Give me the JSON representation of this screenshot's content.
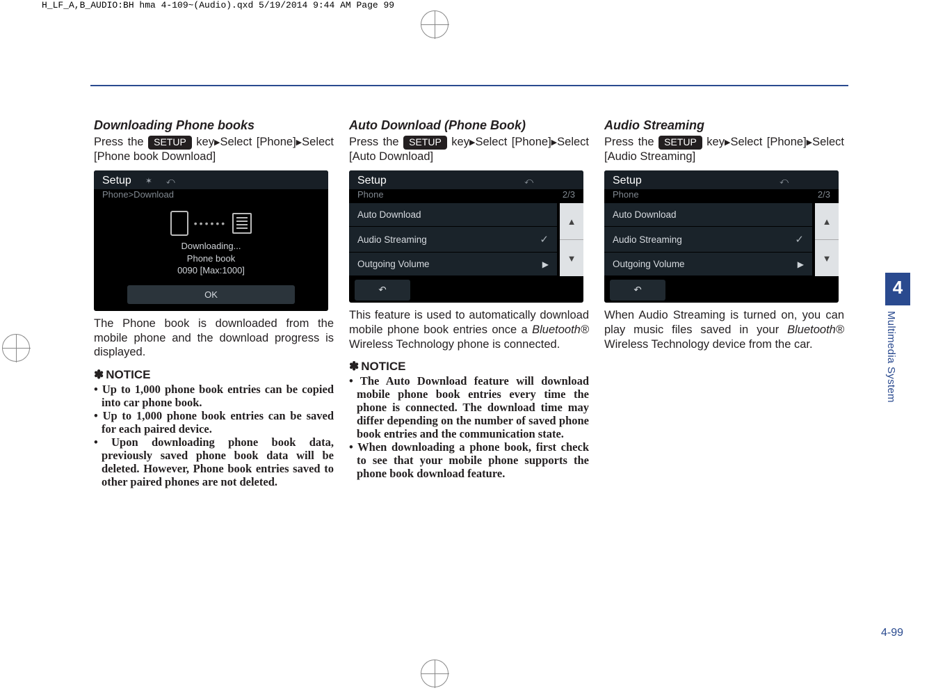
{
  "header_line": "H_LF_A,B_AUDIO:BH hma 4-109~(Audio).qxd  5/19/2014  9:44 AM  Page 99",
  "setup_label": "SETUP",
  "col1": {
    "title": "Downloading Phone books",
    "instr_pre": "Press  the  ",
    "instr_post": "  key",
    "instr_tail": "Select [Phone]",
    "instr_tail2": "Select  [Phone  book Download]",
    "ss": {
      "title": "Setup",
      "breadcrumb": "Phone>Download",
      "downloading": "Downloading...",
      "phonebook": "Phone book",
      "progress": "0090 [Max:1000]",
      "ok": "OK"
    },
    "after_ss": "The Phone book is downloaded from the mobile phone and the download progress is displayed.",
    "notice": "NOTICE",
    "b1": "Up to 1,000 phone book entries can be copied into car phone book.",
    "b2": "Up to 1,000 phone book entries can be saved for each paired device.",
    "b3": "Upon downloading phone book data, previously saved phone book data will be deleted. However, Phone book entries saved to other paired phones are not deleted."
  },
  "col2": {
    "title": "Auto Download (Phone Book)",
    "instr_pre": "Press  the  ",
    "instr_post": "  key",
    "instr_tail": "Select [Phone]",
    "instr_tail2": "Select [Auto Download]",
    "ss": {
      "title": "Setup",
      "sub": "Phone",
      "page": "2/3",
      "row1": "Auto Download",
      "row2": "Audio Streaming",
      "row3": "Outgoing Volume"
    },
    "after_ss_a": "This feature is used to automatically download mobile phone book entries once a ",
    "bt": "Bluetooth®",
    "after_ss_b": " Wireless Technology phone is connected.",
    "notice": "NOTICE",
    "b1": "The Auto Download feature will download mobile phone book entries every time the phone is connected. The download time may differ depending on the number of saved phone book entries and the communication state.",
    "b2": "When downloading a phone book, first check to see that your mobile phone supports the phone book download feature."
  },
  "col3": {
    "title": "Audio Streaming",
    "instr_pre": "Press  the  ",
    "instr_post": "  key",
    "instr_tail": "Select [Phone]",
    "instr_tail2": "Select [Audio Streaming]",
    "ss": {
      "title": "Setup",
      "sub": "Phone",
      "page": "2/3",
      "row1": "Auto Download",
      "row2": "Audio Streaming",
      "row3": "Outgoing Volume"
    },
    "after_ss_a": "When Audio Streaming is turned on, you can play music files saved in your ",
    "bt": "Bluetooth®",
    "after_ss_b": " Wireless Technology device from the car."
  },
  "tab": {
    "num": "4",
    "label": "Multimedia System"
  },
  "pagenum": "4-99"
}
